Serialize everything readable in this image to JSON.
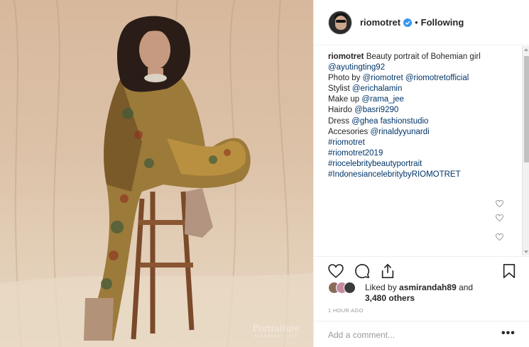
{
  "photo": {
    "alt_subject": "portrait",
    "watermark_main": "Portraiture",
    "watermark_sub": "RIOMOTRET 2019"
  },
  "header": {
    "username": "riomotret",
    "separator": "•",
    "follow_status": "Following"
  },
  "caption": {
    "username": "riomotret",
    "first_line": "Beauty portrait of Bohemian girl",
    "lines": [
      {
        "text": "@ayutingting92",
        "type": "link"
      },
      {
        "text": "Photo by ",
        "type": "plain",
        "links": [
          "@riomotret",
          "@riomotretofficial"
        ]
      },
      {
        "text": "Stylist ",
        "type": "plain",
        "links": [
          "@erichalamin"
        ]
      },
      {
        "text": "Make up ",
        "type": "plain",
        "links": [
          "@rama_jee"
        ]
      },
      {
        "text": "Hairdo ",
        "type": "plain",
        "links": [
          "@basri9290"
        ]
      },
      {
        "text": "Dress ",
        "type": "plain",
        "links": [
          "@ghea fashionstudio"
        ]
      },
      {
        "text": "Accesories ",
        "type": "plain",
        "links": [
          "@rinaldyyunardi"
        ]
      },
      {
        "text": "#riomotret",
        "type": "link"
      },
      {
        "text": "#riomotret2019",
        "type": "link"
      },
      {
        "text": "#riocelebritybeautyportrait",
        "type": "link"
      },
      {
        "text": "#IndonesiancelebritybyRIOMOTRET",
        "type": "link"
      }
    ]
  },
  "likes": {
    "prefix": "Liked by ",
    "user": "asmirandah89",
    "middle": " and",
    "count": "3,480 others"
  },
  "timestamp": "1 HOUR AGO",
  "comment": {
    "placeholder": "Add a comment...",
    "more": "•••"
  },
  "icons": [
    "verified-badge-icon",
    "heart-icon",
    "comment-icon",
    "share-icon",
    "bookmark-icon",
    "more-options-icon"
  ],
  "colors": {
    "link": "#003569",
    "verified": "#3897f0",
    "muted": "#999999",
    "text": "#262626"
  }
}
